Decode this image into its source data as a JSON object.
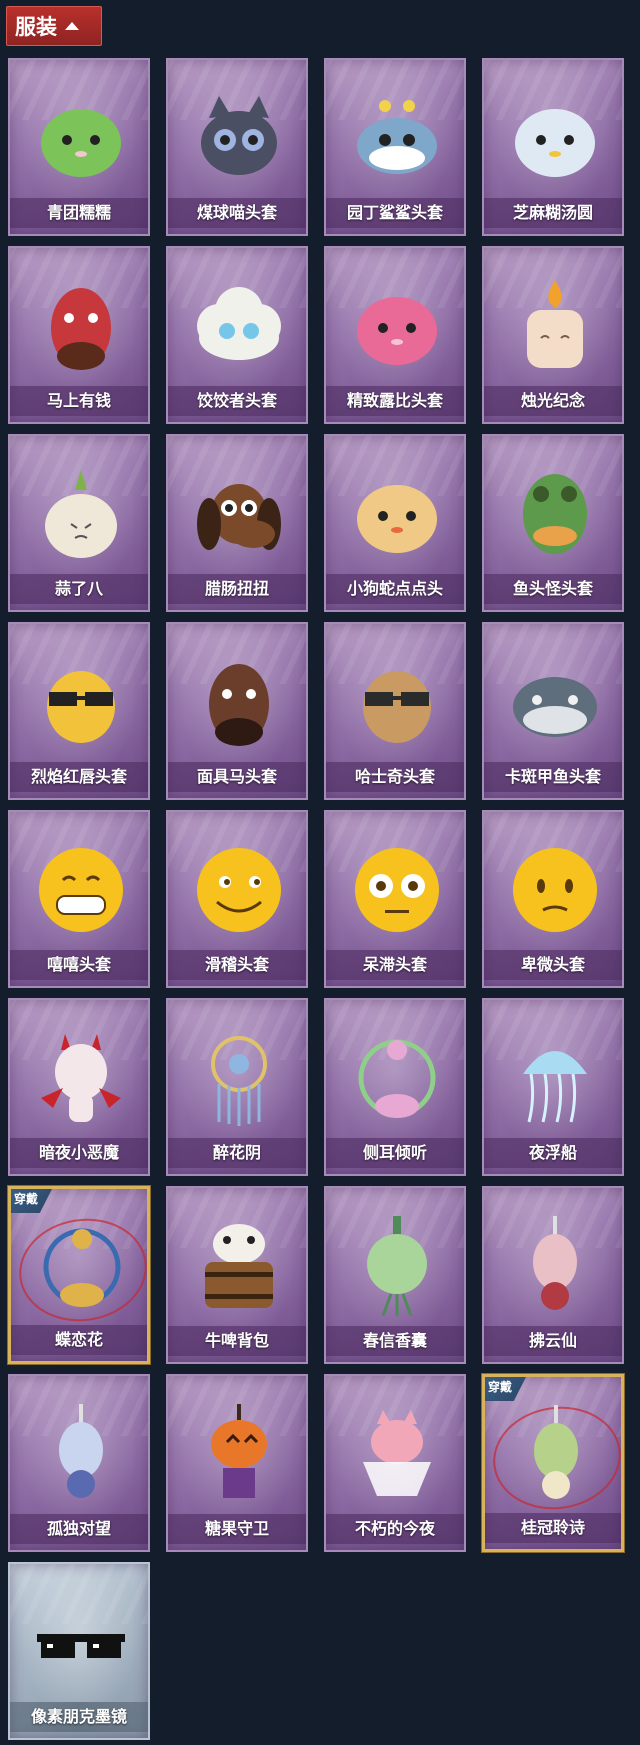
{
  "header": {
    "tab_label": "服装",
    "tab_icon": "chevron-up-icon"
  },
  "colors": {
    "page_background": "#131d2c",
    "tab_background": "#a52a27",
    "card_purple": "#9b7bb0",
    "card_silver": "#a9b8c6",
    "worn_border": "#d8b35a",
    "worn_badge": "#2f4f75"
  },
  "items": [
    {
      "name": "青团糯糯",
      "icon": "green-mochi-head-icon",
      "art_color": "#7cc35a",
      "accent": "#f4c6cf",
      "shape": "blob"
    },
    {
      "name": "煤球喵头套",
      "icon": "black-cat-head-icon",
      "art_color": "#4a4f63",
      "accent": "#9fb4e0",
      "shape": "cat"
    },
    {
      "name": "园丁鲨鲨头套",
      "icon": "shark-head-icon",
      "art_color": "#7fa7c9",
      "accent": "#f2d24b",
      "shape": "shark"
    },
    {
      "name": "芝麻糊汤圆",
      "icon": "rice-ball-head-icon",
      "art_color": "#dfe9f4",
      "accent": "#f2c43c",
      "shape": "blob"
    },
    {
      "name": "马上有钱",
      "icon": "red-horse-head-icon",
      "art_color": "#c6383c",
      "accent": "#5a2a1a",
      "shape": "horse"
    },
    {
      "name": "饺饺者头套",
      "icon": "dumpling-head-icon",
      "art_color": "#f1f1ec",
      "accent": "#75c6e8",
      "shape": "cloud"
    },
    {
      "name": "精致露比头套",
      "icon": "pink-beaver-head-icon",
      "art_color": "#e96a97",
      "accent": "#f4c4d4",
      "shape": "blob"
    },
    {
      "name": "烛光纪念",
      "icon": "candle-head-icon",
      "art_color": "#f3dcc8",
      "accent": "#f2a12c",
      "shape": "candle"
    },
    {
      "name": "蒜了八",
      "icon": "garlic-head-icon",
      "art_color": "#efe7d8",
      "accent": "#7db34a",
      "shape": "garlic"
    },
    {
      "name": "腊肠扭扭",
      "icon": "dachshund-head-icon",
      "art_color": "#7a4a2a",
      "accent": "#3b2416",
      "shape": "dog"
    },
    {
      "name": "小狗蛇点点头",
      "icon": "snake-head-icon",
      "art_color": "#f0c987",
      "accent": "#e86a3a",
      "shape": "blob"
    },
    {
      "name": "鱼头怪头套",
      "icon": "fish-head-icon",
      "art_color": "#5d9a4c",
      "accent": "#e9a24a",
      "shape": "fish"
    },
    {
      "name": "烈焰红唇头套",
      "icon": "yellow-mouse-head-icon",
      "art_color": "#f2c23a",
      "accent": "#222222",
      "shape": "sunglasses"
    },
    {
      "name": "面具马头套",
      "icon": "horse-mask-icon",
      "art_color": "#6a3e2a",
      "accent": "#2e1a12",
      "shape": "horse"
    },
    {
      "name": "哈士奇头套",
      "icon": "husky-head-icon",
      "art_color": "#c99a62",
      "accent": "#2b2b2b",
      "shape": "sunglasses"
    },
    {
      "name": "卡斑甲鱼头套",
      "icon": "turtle-head-icon",
      "art_color": "#5f6e7c",
      "accent": "#f0f0f0",
      "shape": "turtle"
    },
    {
      "name": "嘻嘻头套",
      "icon": "grin-emoji-icon",
      "art_color": "#f7c21e",
      "accent": "#5a3a0a",
      "shape": "emoji-grin"
    },
    {
      "name": "滑稽头套",
      "icon": "smirk-emoji-icon",
      "art_color": "#f7c21e",
      "accent": "#5a3a0a",
      "shape": "emoji-smirk"
    },
    {
      "name": "呆滞头套",
      "icon": "stare-emoji-icon",
      "art_color": "#f7c21e",
      "accent": "#5a3a0a",
      "shape": "emoji-stare"
    },
    {
      "name": "卑微头套",
      "icon": "humble-emoji-icon",
      "art_color": "#f7c21e",
      "accent": "#5a3a0a",
      "shape": "emoji-humble"
    },
    {
      "name": "暗夜小恶魔",
      "icon": "little-devil-icon",
      "art_color": "#f4e7ea",
      "accent": "#c8242c",
      "shape": "devil"
    },
    {
      "name": "醉花阴",
      "icon": "flower-ornament-icon",
      "art_color": "#8fb6e0",
      "accent": "#e0c26a",
      "shape": "ornament"
    },
    {
      "name": "侧耳倾听",
      "icon": "lotus-wreath-icon",
      "art_color": "#e7a9d3",
      "accent": "#8fcf8a",
      "shape": "wreath"
    },
    {
      "name": "夜浮船",
      "icon": "jellyfish-ornament-icon",
      "art_color": "#a9dcf2",
      "accent": "#d6f2ff",
      "shape": "jelly"
    },
    {
      "name": "蝶恋花",
      "icon": "butterfly-bell-icon",
      "art_color": "#e0b24a",
      "accent": "#3a6bb0",
      "shape": "wreath",
      "worn": true,
      "badge": "穿戴"
    },
    {
      "name": "牛啤背包",
      "icon": "cow-beer-backpack-icon",
      "art_color": "#8a5a2e",
      "accent": "#f3f0ea",
      "shape": "barrel"
    },
    {
      "name": "春信香囊",
      "icon": "sachet-icon",
      "art_color": "#a9d49a",
      "accent": "#4e8a5a",
      "shape": "sachet"
    },
    {
      "name": "拂云仙",
      "icon": "crane-pendant-icon",
      "art_color": "#e9c0c6",
      "accent": "#b23a42",
      "shape": "pendant"
    },
    {
      "name": "孤独对望",
      "icon": "figure-pendant-icon",
      "art_color": "#c9d4ef",
      "accent": "#5a6ab0",
      "shape": "pendant"
    },
    {
      "name": "糖果守卫",
      "icon": "pumpkin-pendant-icon",
      "art_color": "#e8772a",
      "accent": "#6b3a8a",
      "shape": "pumpkin"
    },
    {
      "name": "不朽的今夜",
      "icon": "fox-cup-icon",
      "art_color": "#f2a7b8",
      "accent": "#ffffff",
      "shape": "cup"
    },
    {
      "name": "桂冠聆诗",
      "icon": "laurel-pendant-icon",
      "art_color": "#b5d18a",
      "accent": "#f0e6c8",
      "shape": "pendant",
      "worn": true,
      "badge": "穿戴"
    },
    {
      "name": "像素朋克墨镜",
      "icon": "pixel-sunglasses-icon",
      "art_color": "#111111",
      "accent": "#ffffff",
      "shape": "pixel-glasses",
      "silver": true
    }
  ]
}
